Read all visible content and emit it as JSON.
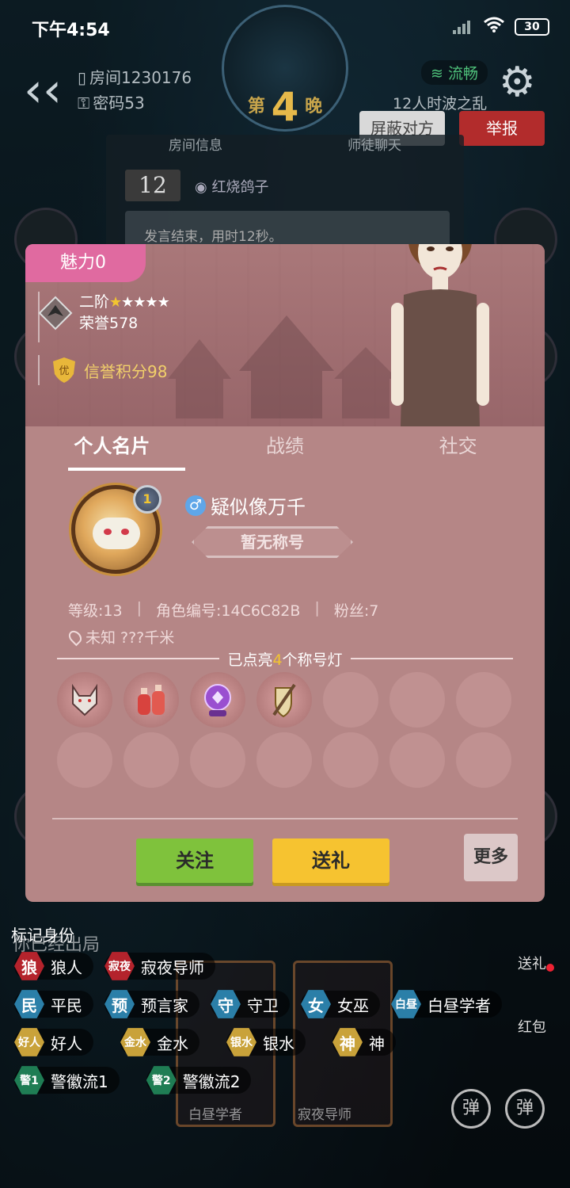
{
  "status_bar": {
    "time": "下午4:54",
    "battery": "30"
  },
  "header": {
    "room_label": "房间1230176",
    "password_label": "密码53",
    "night_prefix": "第",
    "night_number": "4",
    "night_suffix": "晚",
    "connection": "流畅",
    "mode": "12人时波之乱",
    "block_button": "屏蔽对方",
    "report_button": "举报"
  },
  "chat": {
    "tabs": [
      "房间信息",
      "师徒聊天"
    ],
    "seat_number": "12",
    "speaker": "红烧鸽子",
    "message": "发言结束，用时12秒。"
  },
  "profile": {
    "charm": "魅力0",
    "rank": "二阶",
    "stars_gold": "★",
    "stars_white": "★★★★",
    "honor": "荣誉578",
    "credit_icon_text": "优",
    "credit": "信誉积分98",
    "tabs": [
      "个人名片",
      "战绩",
      "社交"
    ],
    "avatar_level": "1",
    "gender_symbol": "♂",
    "nickname": "疑似像万千",
    "title_plate": "暂无称号",
    "level": "等级:13",
    "role_id": "角色编号:14C6C82B",
    "fans": "粉丝:7",
    "location": "未知",
    "distance": "???千米",
    "lamps_prefix": "已点亮",
    "lamps_count": "4",
    "lamps_suffix": "个称号灯",
    "follow_button": "关注",
    "gift_button": "送礼",
    "more_button": "更多"
  },
  "marks": {
    "title": "标记身份",
    "behind_text": "你已经出局",
    "cards": [
      "白昼学者",
      "寂夜导师"
    ],
    "row1": [
      {
        "icon": "狼",
        "label": "狼人",
        "color": "red"
      },
      {
        "icon": "寂夜",
        "label": "寂夜导师",
        "color": "red"
      }
    ],
    "row2": [
      {
        "icon": "民",
        "label": "平民",
        "color": "blue"
      },
      {
        "icon": "预",
        "label": "预言家",
        "color": "blue"
      },
      {
        "icon": "守",
        "label": "守卫",
        "color": "blue"
      },
      {
        "icon": "女",
        "label": "女巫",
        "color": "blue"
      },
      {
        "icon": "白昼",
        "label": "白昼学者",
        "color": "blue"
      }
    ],
    "row3": [
      {
        "icon": "好人",
        "label": "好人",
        "color": "gold"
      },
      {
        "icon": "金水",
        "label": "金水",
        "color": "gold"
      },
      {
        "icon": "银水",
        "label": "银水",
        "color": "gold"
      },
      {
        "icon": "神",
        "label": "神",
        "color": "gold"
      }
    ],
    "row4": [
      {
        "icon": "警1",
        "label": "警徽流1",
        "color": "green"
      },
      {
        "icon": "警2",
        "label": "警徽流2",
        "color": "green"
      }
    ]
  },
  "side": {
    "gift": "送礼",
    "red_packet": "红包",
    "danmu": "弹"
  }
}
